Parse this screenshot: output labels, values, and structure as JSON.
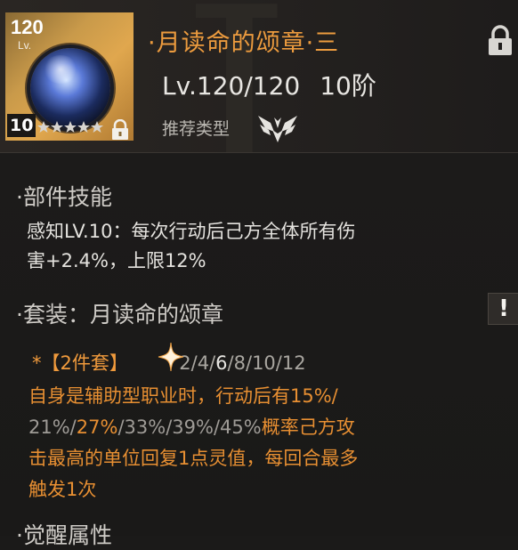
{
  "item": {
    "level": "120",
    "lv_label": "Lv.",
    "rank": "10",
    "stars": 5,
    "name": "·月读命的颂章·三",
    "level_text": "Lv.120/120",
    "tier_text": "10阶",
    "recommend_label": "推荐类型"
  },
  "skill": {
    "heading": "·部件技能",
    "line1": "感知LV.10：每次行动后己方全体所有伤",
    "line2": "害+2.4%，上限12%"
  },
  "set": {
    "heading": "·套装：月读命的颂章",
    "alert_label": "!",
    "tag": "*【2件套】",
    "counts": [
      "2",
      "4",
      "6",
      "8",
      "10",
      "12"
    ],
    "active_count": "6",
    "effect_line1": "自身是辅助型职业时，行动后有15%/",
    "effect_line2_parts": [
      "21%/",
      "27%",
      "/33%/39%/45%",
      "概率己方攻"
    ],
    "effect_line3": "击最高的单位回复1点灵值，每回合最多",
    "effect_line4": "触发1次"
  },
  "bottom": {
    "heading": "·觉醒属性"
  },
  "colors": {
    "accent_orange": "#ec9b3e",
    "text_main": "#e4e2de",
    "text_dim": "#a9a6a0",
    "background": "#1b1a19"
  }
}
